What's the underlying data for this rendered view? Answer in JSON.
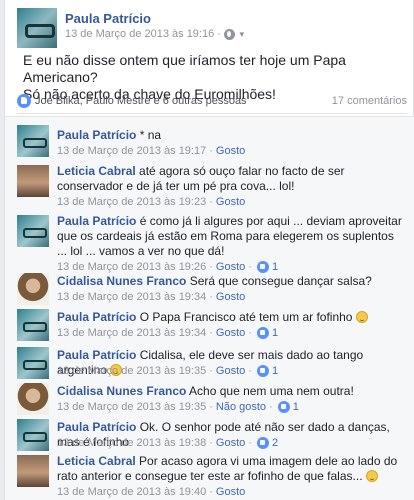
{
  "post": {
    "author": "Paula Patrício",
    "timestamp": "13 de Março de 2013 às 19:16",
    "separator": "·",
    "text_line1": "E eu não disse ontem que iríamos ter hoje um Papa Americano?",
    "text_line2": "Só não acerto da chave do Euromilhões!",
    "likers": "Joe Blika, Paulo Mestre e 6 outras pessoas",
    "comment_count": "17 comentários"
  },
  "comments": [
    {
      "author": "Paula Patrício",
      "text": "* na",
      "time": "13 de Março de 2013 às 19:17",
      "like_link": "Gosto",
      "likes": ""
    },
    {
      "author": "Leticia Cabral",
      "text": "até agora só ouço falar no facto de ser conservador e de já ter um pé pra cova... lol!",
      "time": "13 de Março de 2013 às 19:23",
      "like_link": "Gosto",
      "likes": ""
    },
    {
      "author": "Paula Patrício",
      "text": "é como já li algures por aqui ... deviam aproveitar que os cardeais já estão em Roma para elegerem os suplentos ... lol ... vamos a ver no que dá!",
      "time": "13 de Março de 2013 às 19:26",
      "like_link": "Gosto",
      "likes": "1"
    },
    {
      "author": "Cidalisa Nunes Franco",
      "text": "Será que consegue dançar salsa?",
      "time": "13 de Março de 2013 às 19:34",
      "like_link": "Gosto",
      "likes": ""
    },
    {
      "author": "Paula Patrício",
      "text": "O Papa Francisco até tem um ar fofinho",
      "time": "13 de Março de 2013 às 19:34",
      "like_link": "Gosto",
      "likes": "1"
    },
    {
      "author": "Paula Patrício",
      "text": "Cidalisa, ele deve ser mais dado ao tango argentino",
      "time": "13 de Março de 2013 às 19:35",
      "like_link": "Gosto",
      "likes": "1"
    },
    {
      "author": "Cidalisa Nunes Franco",
      "text": "Acho que nem uma nem outra!",
      "time": "13 de Março de 2013 às 19:35",
      "like_link": "Não gosto",
      "likes": "1"
    },
    {
      "author": "Paula Patrício",
      "text": "Ok. O senhor pode até não ser dado a danças, mas é fofinho",
      "time": "13 de Março de 2013 às 19:38",
      "like_link": "Gosto",
      "likes": "2"
    },
    {
      "author": "Leticia Cabral",
      "text": "Por acaso agora vi uma imagem dele ao lado do rato anterior e consegue ter este ar fofinho de que falas...",
      "time": "13 de Março de 2013 às 19:40",
      "like_link": "Gosto",
      "likes": ""
    }
  ],
  "colors": {
    "link_blue": "#365899",
    "meta_gray": "#90949c",
    "like_blue": "#5890ff"
  },
  "icons": {
    "audience": "globe-icon",
    "menu": "caret-down-icon",
    "reaction": "like-icon",
    "emoji": "smiley-icon"
  }
}
